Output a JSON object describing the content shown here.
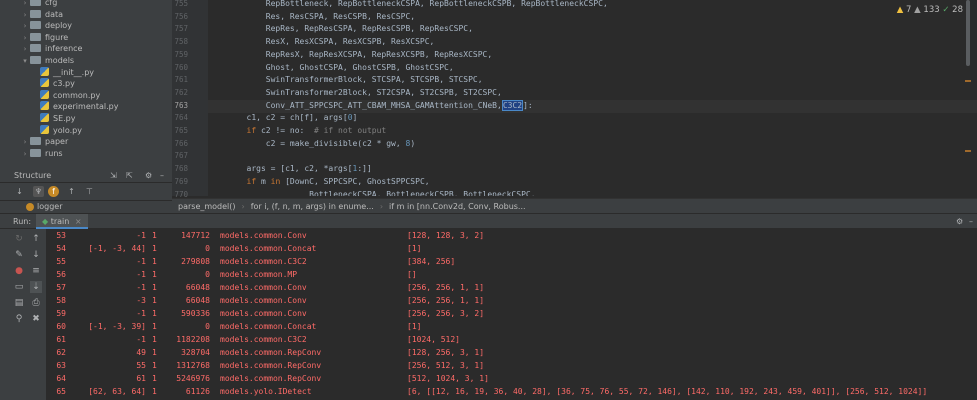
{
  "project_tree": {
    "rows": [
      {
        "indent": 1,
        "folder": true,
        "expanded": false,
        "label": "cfg"
      },
      {
        "indent": 1,
        "folder": true,
        "expanded": false,
        "label": "data"
      },
      {
        "indent": 1,
        "folder": true,
        "expanded": false,
        "label": "deploy"
      },
      {
        "indent": 1,
        "folder": true,
        "expanded": false,
        "label": "figure"
      },
      {
        "indent": 1,
        "folder": true,
        "expanded": false,
        "label": "inference"
      },
      {
        "indent": 1,
        "folder": true,
        "expanded": true,
        "label": "models"
      },
      {
        "indent": 2,
        "folder": false,
        "label": "__init__.py"
      },
      {
        "indent": 2,
        "folder": false,
        "label": "c3.py"
      },
      {
        "indent": 2,
        "folder": false,
        "label": "common.py"
      },
      {
        "indent": 2,
        "folder": false,
        "label": "experimental.py"
      },
      {
        "indent": 2,
        "folder": false,
        "label": "SE.py"
      },
      {
        "indent": 2,
        "folder": false,
        "label": "yolo.py"
      },
      {
        "indent": 1,
        "folder": true,
        "expanded": false,
        "label": "paper"
      },
      {
        "indent": 1,
        "folder": true,
        "expanded": false,
        "label": "runs"
      }
    ]
  },
  "editor": {
    "line_numbers": [
      "755",
      "756",
      "757",
      "758",
      "759",
      "760",
      "761",
      "762",
      "763",
      "764",
      "765",
      "766",
      "767",
      "768",
      "769",
      "770"
    ],
    "current_line": "763",
    "lines": [
      [
        {
          "t": "            RepBottleneck, RepBottleneckCSPA, RepBottleneckCSPB, RepBottleneckCSPC,",
          "c": ""
        }
      ],
      [
        {
          "t": "            Res, ResCSPA, ResCSPB, ResCSPC,",
          "c": ""
        }
      ],
      [
        {
          "t": "            RepRes, RepResCSPA, RepResCSPB, RepResCSPC,",
          "c": ""
        }
      ],
      [
        {
          "t": "            ResX, ResXCSPA, ResXCSPB, ResXCSPC,",
          "c": ""
        }
      ],
      [
        {
          "t": "            RepResX, RepResXCSPA, RepResXCSPB, RepResXCSPC,",
          "c": ""
        }
      ],
      [
        {
          "t": "            Ghost, GhostCSPA, GhostCSPB, GhostCSPC,",
          "c": ""
        }
      ],
      [
        {
          "t": "            SwinTransformerBlock, STCSPA, STCSPB, STCSPC,",
          "c": ""
        }
      ],
      [
        {
          "t": "            SwinTransformer2Block, ST2CSPA, ST2CSPB, ST2CSPC,",
          "c": ""
        }
      ],
      [
        {
          "t": "            Conv_ATT_SPPCSPC_ATT_CBAM_MHSA_GAMAttention_CNeB,",
          "c": ""
        },
        {
          "t": "C3C2",
          "c": "sel"
        },
        {
          "t": "]:",
          "c": ""
        }
      ],
      [
        {
          "t": "        c1, c2 = ch[f], args[",
          "c": ""
        },
        {
          "t": "0",
          "c": "nm"
        },
        {
          "t": "]",
          "c": ""
        }
      ],
      [
        {
          "t": "        ",
          "c": ""
        },
        {
          "t": "if",
          "c": "kw"
        },
        {
          "t": " c2 != no:  ",
          "c": ""
        },
        {
          "t": "# if not output",
          "c": "cm"
        }
      ],
      [
        {
          "t": "            c2 = make_divisible(c2 * gw, ",
          "c": ""
        },
        {
          "t": "8",
          "c": "nm"
        },
        {
          "t": ")",
          "c": ""
        }
      ],
      [
        {
          "t": "",
          "c": ""
        }
      ],
      [
        {
          "t": "        args = [c1, c2, *args[",
          "c": ""
        },
        {
          "t": "1",
          "c": "nm"
        },
        {
          "t": ":]]",
          "c": ""
        }
      ],
      [
        {
          "t": "        ",
          "c": ""
        },
        {
          "t": "if",
          "c": "kw"
        },
        {
          "t": " m ",
          "c": ""
        },
        {
          "t": "in",
          "c": "kw"
        },
        {
          "t": " [DownC, SPPCSPC, GhostSPPCSPC,",
          "c": ""
        }
      ],
      [
        {
          "t": "                     BottleneckCSPA, BottleneckCSPB, BottleneckCSPC,",
          "c": ""
        }
      ]
    ]
  },
  "inspections": {
    "warnings": "7",
    "weak_warnings": "133",
    "typos": "28"
  },
  "structure": {
    "title": "Structure",
    "item": "logger"
  },
  "breadcrumbs": [
    "parse_model()",
    "for i, (f, n, m, args) in enume...",
    "if m in [nn.Conv2d, Conv, Robus..."
  ],
  "run": {
    "label": "Run:",
    "tab": "train"
  },
  "output": {
    "rows": [
      [
        "53",
        "-1",
        "1",
        "147712",
        "models.common.Conv",
        "[128, 128, 3, 2]"
      ],
      [
        "54",
        "[-1, -3, 44]",
        "1",
        "0",
        "models.common.Concat",
        "[1]"
      ],
      [
        "55",
        "-1",
        "1",
        "279808",
        "models.common.C3C2",
        "[384, 256]"
      ],
      [
        "56",
        "-1",
        "1",
        "0",
        "models.common.MP",
        "[]"
      ],
      [
        "57",
        "-1",
        "1",
        "66048",
        "models.common.Conv",
        "[256, 256, 1, 1]"
      ],
      [
        "58",
        "-3",
        "1",
        "66048",
        "models.common.Conv",
        "[256, 256, 1, 1]"
      ],
      [
        "59",
        "-1",
        "1",
        "590336",
        "models.common.Conv",
        "[256, 256, 3, 2]"
      ],
      [
        "60",
        "[-1, -3, 39]",
        "1",
        "0",
        "models.common.Concat",
        "[1]"
      ],
      [
        "61",
        "-1",
        "1",
        "1182208",
        "models.common.C3C2",
        "[1024, 512]"
      ],
      [
        "62",
        "49",
        "1",
        "328704",
        "models.common.RepConv",
        "[128, 256, 3, 1]"
      ],
      [
        "63",
        "55",
        "1",
        "1312768",
        "models.common.RepConv",
        "[256, 512, 3, 1]"
      ],
      [
        "64",
        "61",
        "1",
        "5246976",
        "models.common.RepConv",
        "[512, 1024, 3, 1]"
      ],
      [
        "65",
        "[62, 63, 64]",
        "1",
        "61126",
        "models.yolo.IDetect",
        "[6, [[12, 16, 19, 36, 40, 28], [36, 75, 76, 55, 72, 146], [142, 110, 192, 243, 459, 401]], [256, 512, 1024]]"
      ]
    ]
  },
  "colors": {
    "error_text": "#ff6b68",
    "accent": "#4a88c7",
    "keyword": "#cc7832"
  }
}
